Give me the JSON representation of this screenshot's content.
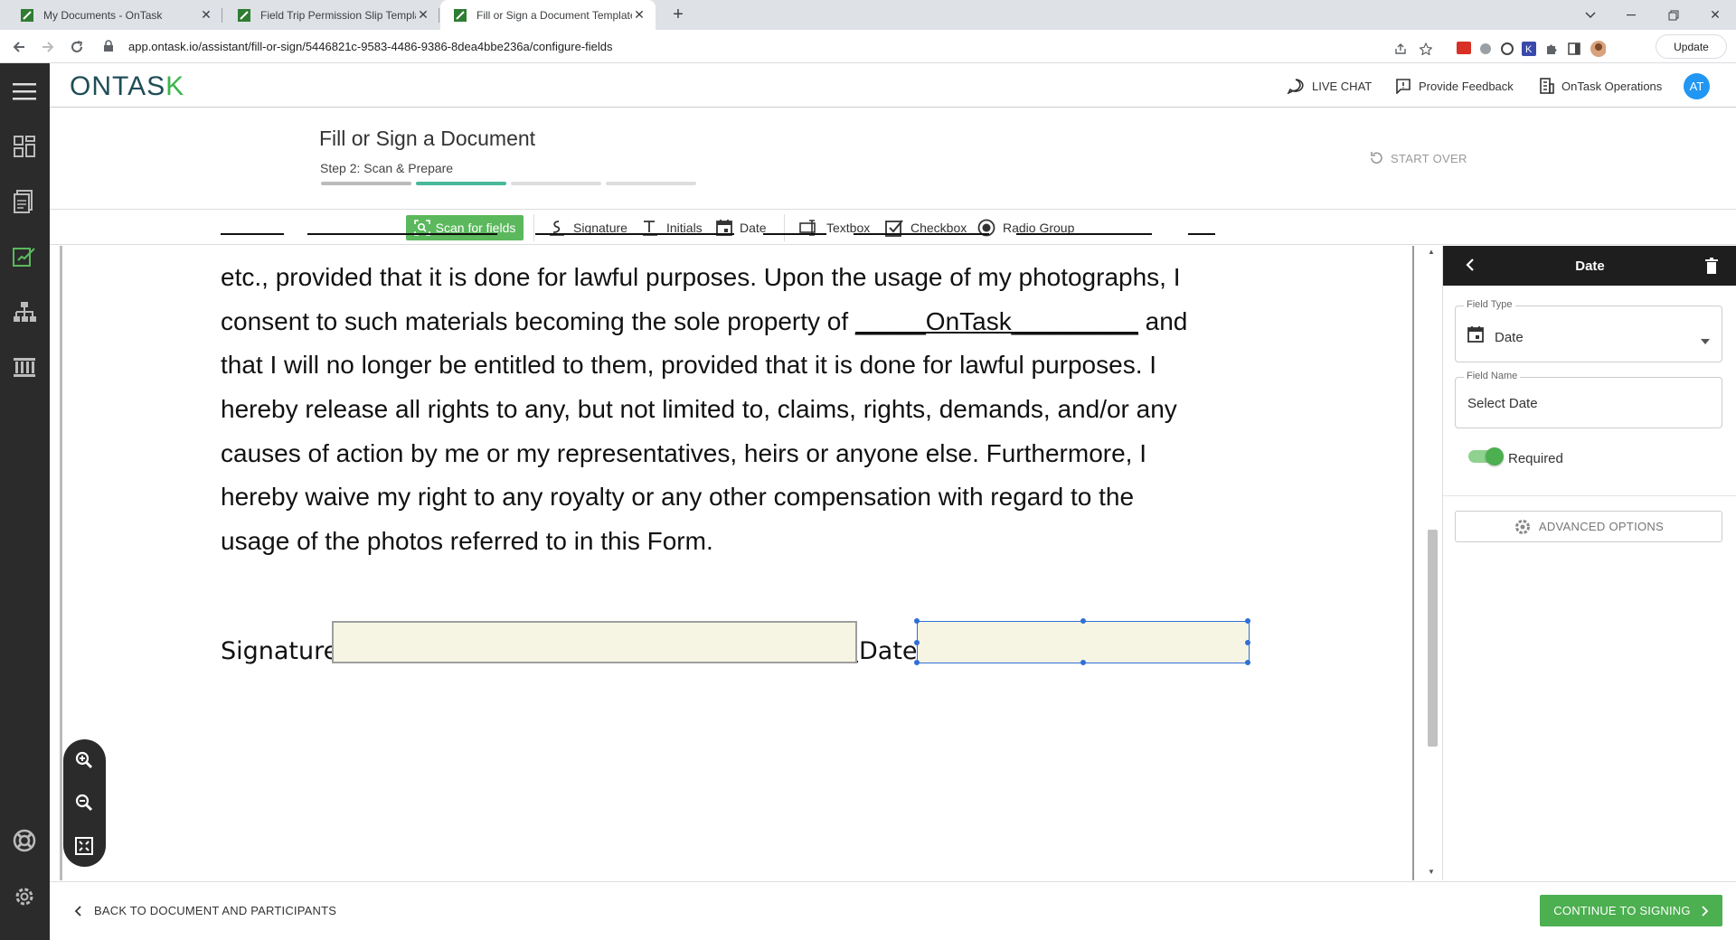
{
  "browser": {
    "tabs": [
      {
        "title": "My Documents - OnTask",
        "active": false
      },
      {
        "title": "Field Trip Permission Slip Templat",
        "active": false
      },
      {
        "title": "Fill or Sign a Document Template",
        "active": true
      }
    ],
    "url": "app.ontask.io/assistant/fill-or-sign/5446821c-9583-4486-9386-8dea4bbe236a/configure-fields",
    "update_label": "Update"
  },
  "header": {
    "logo_main": "ONTAS",
    "logo_k": "K",
    "live_chat": "LIVE CHAT",
    "feedback": "Provide Feedback",
    "org": "OnTask Operations",
    "avatar": "AT"
  },
  "page": {
    "title": "Fill or Sign a Document",
    "step": "Step 2: Scan & Prepare",
    "start_over": "START OVER",
    "progress_steps": 4,
    "current_step": 2
  },
  "toolbar": {
    "scan": "Scan for fields",
    "signature": "Signature",
    "initials": "Initials",
    "date": "Date",
    "textbox": "Textbox",
    "checkbox": "Checkbox",
    "radio": "Radio Group"
  },
  "document": {
    "line1": "etc., provided that it is done for lawful purposes. Upon the usage of my photographs, I",
    "line2_pre": "consent to such materials becoming the sole property of ",
    "line2_under": "_____OnTask_________",
    "line2_post": " and",
    "line3": "that I will no longer be entitled to them, provided that it is done for lawful purposes. I",
    "line4": "hereby release all rights to any, but not limited to, claims, rights, demands, and/or any",
    "line5": "causes of action by me or my representatives, heirs or anyone else. Furthermore, I",
    "line6": "hereby waive my right to any royalty or any other compensation with regard to the",
    "line7": "usage of the photos referred to in this Form.",
    "signature_label": "Signature:",
    "date_label": "Date:"
  },
  "panel": {
    "title": "Date",
    "field_type_label": "Field Type",
    "field_type_value": "Date",
    "field_name_label": "Field Name",
    "field_name_value": "Select Date",
    "required_label": "Required",
    "required": true,
    "advanced": "ADVANCED OPTIONS"
  },
  "footer": {
    "back": "BACK TO DOCUMENT AND PARTICIPANTS",
    "continue": "CONTINUE TO SIGNING"
  },
  "colors": {
    "accent_green": "#4caf50",
    "brand_teal": "#1f4e57",
    "sidebar_dark": "#2b2b2b",
    "field_fill": "#f6f4e3",
    "selection_blue": "#2f6fd6"
  }
}
